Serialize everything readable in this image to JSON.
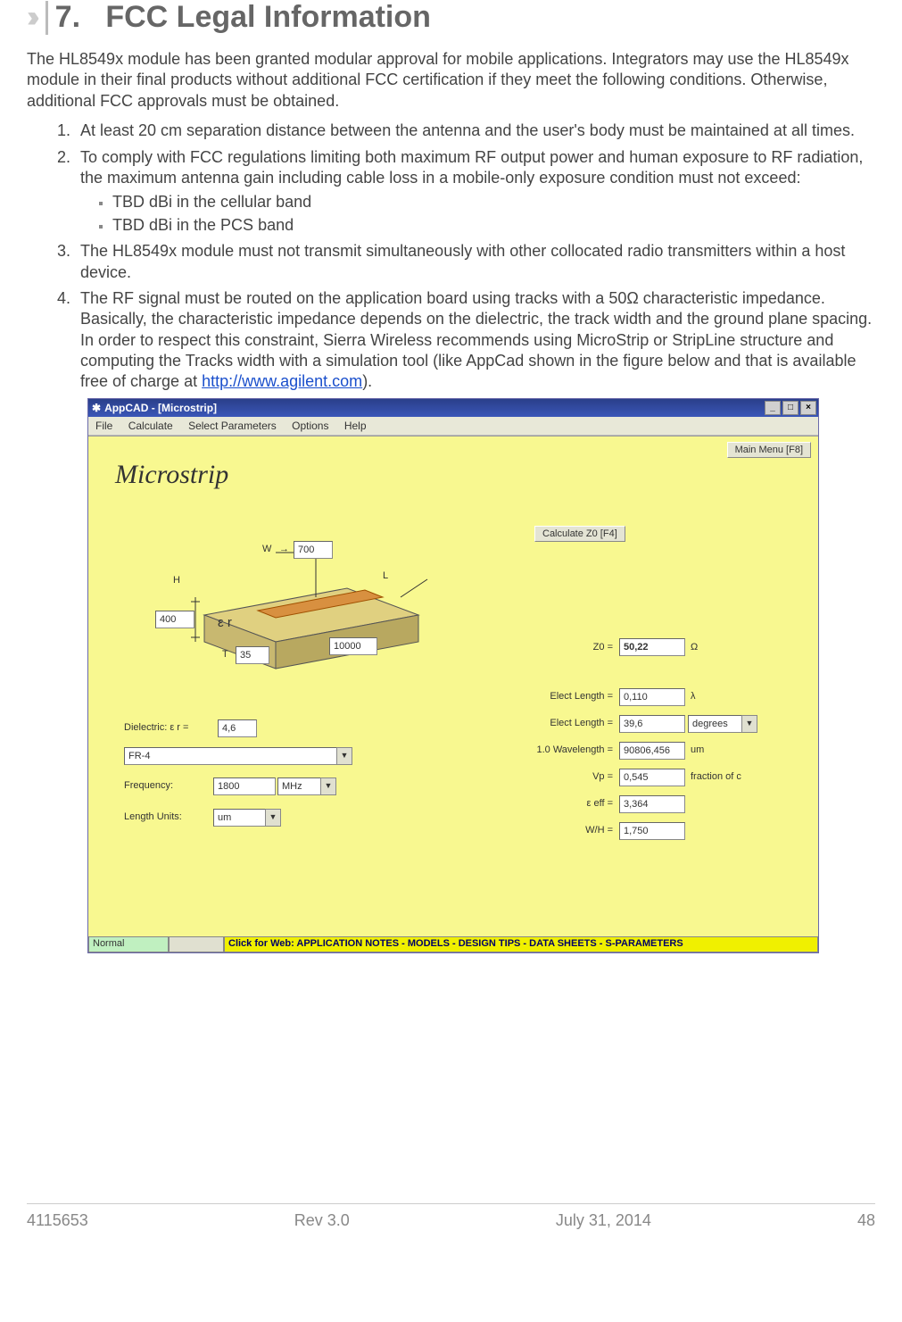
{
  "heading_num": "7.",
  "heading_text": "FCC Legal Information",
  "intro": "The HL8549x module has been granted modular approval for mobile applications. Integrators may use the HL8549x module in their final products without additional FCC certification if they meet the following conditions. Otherwise, additional FCC approvals must be obtained.",
  "list": {
    "item1": "At least 20 cm separation distance between the antenna and the user's body must be maintained at all times.",
    "item2": "To comply with FCC regulations limiting both maximum RF output power and human exposure to RF radiation, the maximum antenna gain including cable loss in a mobile-only exposure condition must not exceed:",
    "item2_sub1": "TBD dBi in the cellular band",
    "item2_sub2": "TBD dBi in the PCS band",
    "item3": "The HL8549x module must not transmit simultaneously with other collocated radio transmitters within a host device.",
    "item4_a": "The RF signal must be routed on the application board using tracks with a 50Ω characteristic impedance. Basically, the characteristic impedance depends on the dielectric, the track width and the ground plane spacing. In order to respect this constraint, Sierra Wireless recommends using MicroStrip or StripLine structure and computing the Tracks width with a simulation tool (like AppCad shown in the figure below and that is available free of charge at ",
    "item4_link": "http://www.agilent.com",
    "item4_b": ")."
  },
  "appcad": {
    "title": "AppCAD - [Microstrip]",
    "menus": [
      "File",
      "Calculate",
      "Select Parameters",
      "Options",
      "Help"
    ],
    "main_menu_btn": "Main Menu [F8]",
    "section_title": "Microstrip",
    "calc_btn": "Calculate Z0 [F4]",
    "diagram": {
      "W": "W",
      "H": "H",
      "T": "T",
      "L": "L",
      "er": "ε r",
      "W_val": "700",
      "H_val": "400",
      "T_val": "35",
      "L_val": "10000"
    },
    "left": {
      "dielectric_lbl": "Dielectric:   ε r  =",
      "dielectric_val": "4,6",
      "material": "FR-4",
      "freq_lbl": "Frequency:",
      "freq_val": "1800",
      "freq_unit": "MHz",
      "length_lbl": "Length Units:",
      "length_val": "um"
    },
    "right": {
      "z0_lbl": "Z0 =",
      "z0_val": "50,22",
      "z0_unit": "Ω",
      "elen1_lbl": "Elect Length =",
      "elen1_val": "0,110",
      "elen1_unit": "λ",
      "elen2_lbl": "Elect Length =",
      "elen2_val": "39,6",
      "elen2_unit": "degrees",
      "wl_lbl": "1.0 Wavelength =",
      "wl_val": "90806,456",
      "wl_unit": "um",
      "vp_lbl": "Vp =",
      "vp_val": "0,545",
      "vp_unit": "fraction of c",
      "eeff_lbl": "ε eff =",
      "eeff_val": "3,364",
      "wh_lbl": "W/H =",
      "wh_val": "1,750"
    },
    "status_left": "Normal",
    "status_mid": "Click for Web: APPLICATION NOTES - MODELS - DESIGN TIPS - DATA SHEETS - S-PARAMETERS"
  },
  "footer": {
    "doc_id": "4115653",
    "rev": "Rev 3.0",
    "date": "July 31, 2014",
    "page": "48"
  }
}
